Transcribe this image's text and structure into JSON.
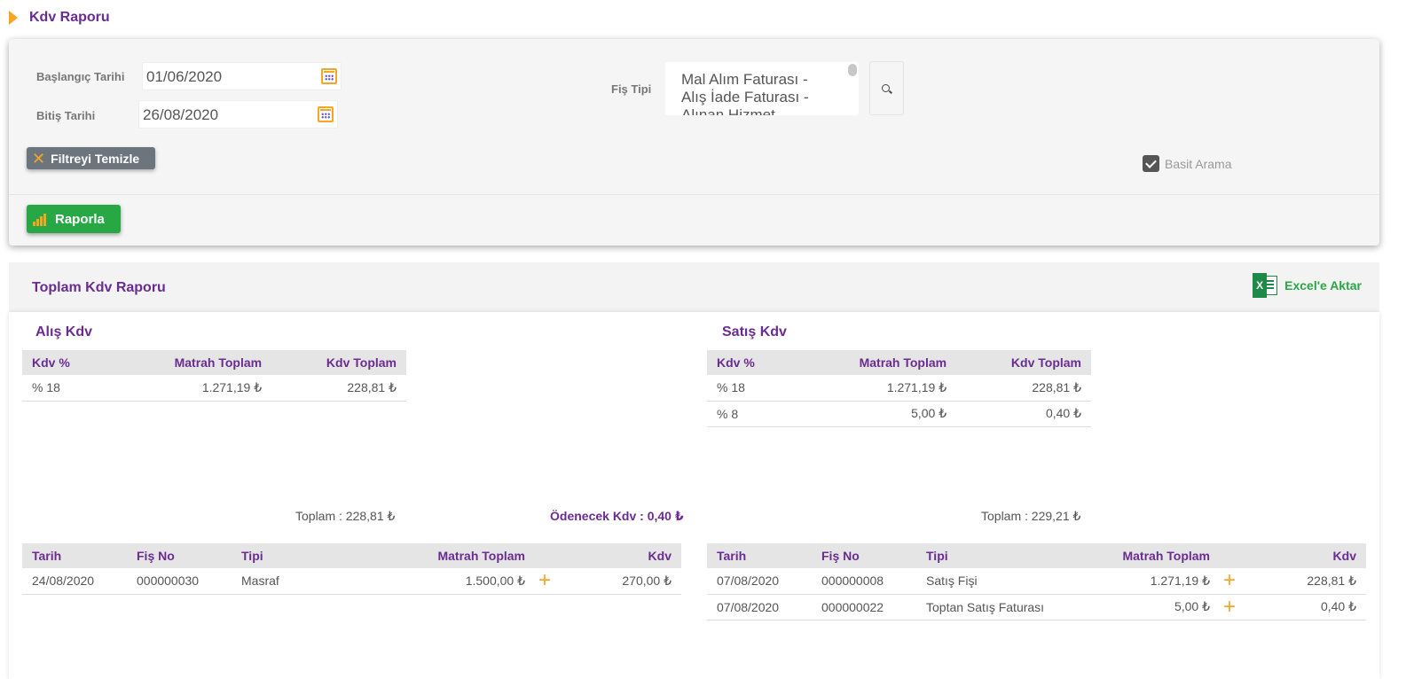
{
  "page": {
    "title": "Kdv Raporu"
  },
  "filter": {
    "start_date_label": "Başlangıç Tarihi",
    "start_date_value": "01/06/2020",
    "end_date_label": "Bitiş Tarihi",
    "end_date_value": "26/08/2020",
    "fis_tipi_label": "Fiş Tipi",
    "fis_tipi_options": [
      "Mal Alım Faturası -",
      "Alış İade Faturası -",
      "Alınan Hizmet"
    ],
    "clear_button": "Filtreyi Temizle",
    "basit_arama_label": "Basit Arama",
    "basit_arama_checked": true,
    "report_button": "Raporla"
  },
  "summary": {
    "title": "Toplam Kdv Raporu",
    "excel_button": "Excel'e Aktar",
    "alis": {
      "title": "Alış Kdv",
      "headers": [
        "Kdv %",
        "Matrah Toplam",
        "Kdv Toplam"
      ],
      "rows": [
        [
          "% 18",
          "1.271,19 ₺",
          "228,81 ₺"
        ]
      ],
      "total": "Toplam : 228,81 ₺"
    },
    "satis": {
      "title": "Satış Kdv",
      "headers": [
        "Kdv %",
        "Matrah Toplam",
        "Kdv Toplam"
      ],
      "rows": [
        [
          "% 18",
          "1.271,19 ₺",
          "228,81 ₺"
        ],
        [
          "% 8",
          "5,00 ₺",
          "0,40 ₺"
        ]
      ],
      "total": "Toplam : 229,21 ₺"
    },
    "odenecek": "Ödenecek Kdv : 0,40 ₺",
    "alis_detail": {
      "headers": [
        "Tarih",
        "Fiş No",
        "Tipi",
        "Matrah Toplam",
        "Kdv"
      ],
      "rows": [
        [
          "24/08/2020",
          "000000030",
          "Masraf",
          "1.500,00 ₺",
          "270,00 ₺"
        ]
      ]
    },
    "satis_detail": {
      "headers": [
        "Tarih",
        "Fiş No",
        "Tipi",
        "Matrah Toplam",
        "Kdv"
      ],
      "rows": [
        [
          "07/08/2020",
          "000000008",
          "Satış Fişi",
          "1.271,19 ₺",
          "228,81 ₺"
        ],
        [
          "07/08/2020",
          "000000022",
          "Toptan Satış Faturası",
          "5,00 ₺",
          "0,40 ₺"
        ]
      ]
    }
  },
  "colors": {
    "brand_purple": "#6a2c91",
    "accent_orange": "#f5a623",
    "success_green": "#28a745"
  }
}
